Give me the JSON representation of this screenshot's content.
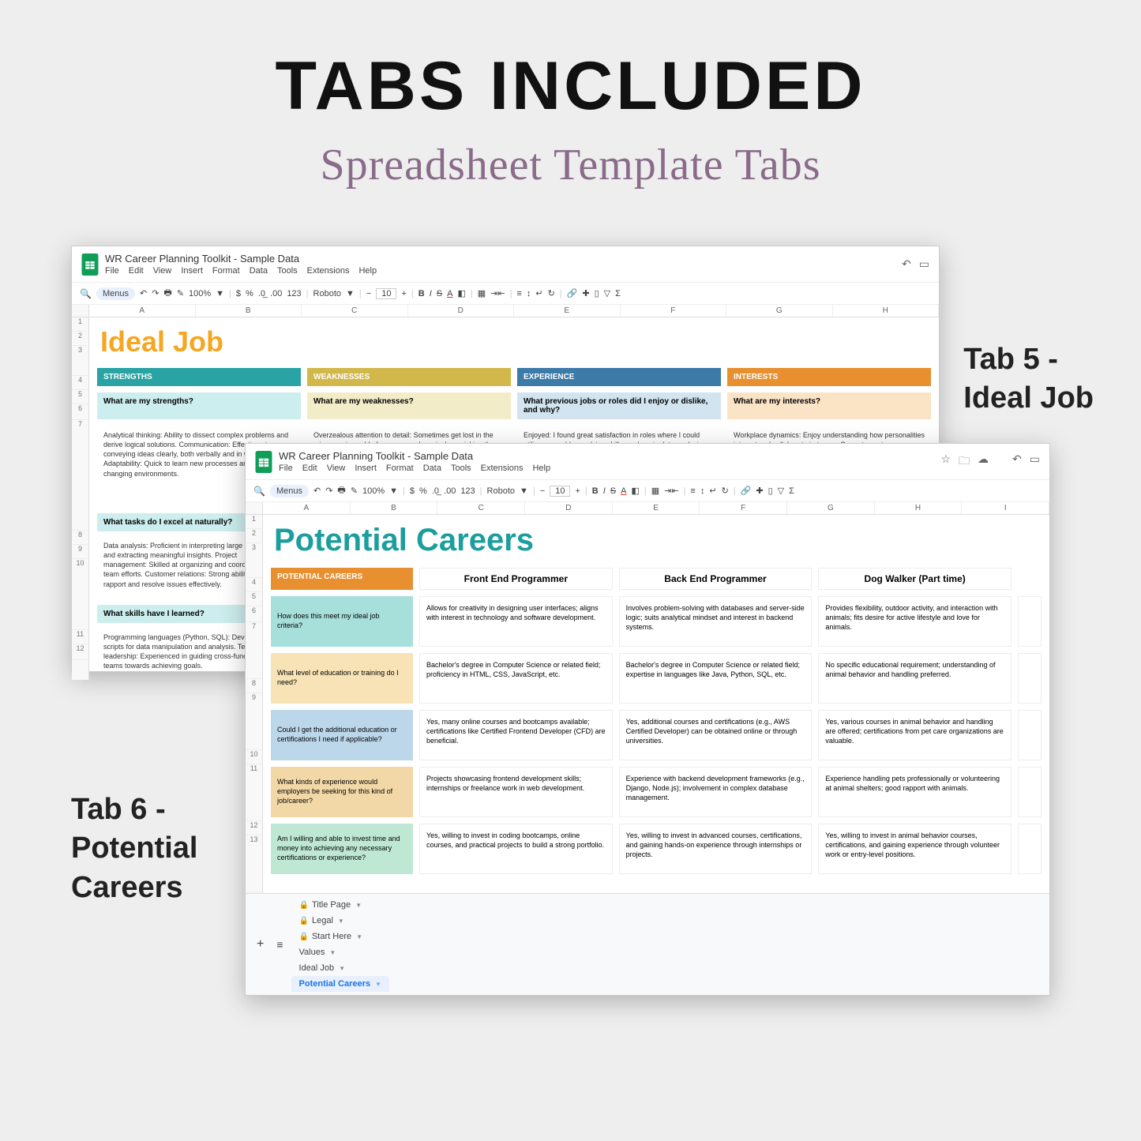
{
  "hero": {
    "title": "TABS INCLUDED",
    "subtitle": "Spreadsheet Template Tabs"
  },
  "labels": {
    "right": "Tab 5 -\nIdeal Job",
    "left": "Tab 6 -\nPotential\nCareers"
  },
  "doc": {
    "title": "WR Career Planning Toolkit - Sample Data",
    "menus": [
      "File",
      "Edit",
      "View",
      "Insert",
      "Format",
      "Data",
      "Tools",
      "Extensions",
      "Help"
    ],
    "search": "Menus",
    "font": "Roboto",
    "fontsize": "10",
    "zoom": "100%",
    "cols_back": [
      "A",
      "B",
      "C",
      "D",
      "E",
      "F",
      "G",
      "H"
    ],
    "cols_front": [
      "A",
      "B",
      "C",
      "D",
      "E",
      "F",
      "G",
      "H",
      "I"
    ]
  },
  "tabs": [
    "Title Page",
    "Legal",
    "Start Here",
    "Values",
    "Ideal Job",
    "Potential Careers"
  ],
  "idealJob": {
    "heading": "Ideal Job",
    "columns": [
      {
        "head": "STRENGTHS",
        "headClass": "c-teal",
        "sub": "What are my strengths?",
        "subClass": "c-tealL",
        "text": "Analytical thinking: Ability to dissect complex problems and derive logical solutions.\nCommunication: Effective at conveying ideas clearly, both verbally and in writing.\nAdaptability: Quick to learn new processes and adjust to changing environments."
      },
      {
        "head": "WEAKNESSES",
        "headClass": "c-gold",
        "sub": "What are my weaknesses?",
        "subClass": "c-goldL",
        "text": "Overzealous attention to detail: Sometimes get lost in the microscopic world of commas and semicolons, risking the big picture.\nSpontaneous pun syndrome: Occasionally suffer from a spontaneous outbreak of puns, which can derail serious discussions.\nOccasional nocturnal coding: Have been known to wake up with algorithms on the mind, leading to unconventional sleep schedules."
      },
      {
        "head": "EXPERIENCE",
        "headClass": "c-blue",
        "sub": "What previous jobs or roles did I enjoy or dislike, and why?",
        "subClass": "c-blueL",
        "text": "Enjoyed: I found great satisfaction in roles where I could utilize my problem-solving skills, such as in data analysis or project management. These roles allowed me to tackle challenges methodically and see tangible results.\nDisliked: Positions requiring extensive cold calling or sales pitches were challenging for me. I struggled with the pressure of initiating conversations and persuading others."
      },
      {
        "head": "INTERESTS",
        "headClass": "c-orng",
        "sub": "What are my interests?",
        "subClass": "c-orngL",
        "text": "Workplace dynamics: Enjoy understanding how personalities interact and collaborate in teams.\nCurrent events discussions: Like staying informed and discussing how it impacts our work.\nPersonal development: Interested in learning communication styles and improving teamwork."
      }
    ],
    "second": {
      "sub": "What tasks do I excel at naturally?",
      "text": "Data analysis: Proficient in interpreting large datasets and extracting meaningful insights.\nProject management: Skilled at organizing and coordinating team efforts.\nCustomer relations: Strong ability to build rapport and resolve issues effectively."
    },
    "third": {
      "sub": "What skills have I learned?",
      "text": "Programming languages (Python, SQL): Developed scripts for data manipulation and analysis.\nTeam leadership: Experienced in guiding cross-functional teams towards achieving goals."
    }
  },
  "potential": {
    "heading": "Potential Careers",
    "cornerHead": "POTENTIAL CAREERS",
    "colHeads": [
      "Front End Programmer",
      "Back End Programmer",
      "Dog Walker (Part time)"
    ],
    "rows": [
      {
        "q": "How does this meet my ideal job criteria?",
        "qClass": "q-teal",
        "a": [
          "Allows for creativity in designing user interfaces; aligns with interest in technology and software development.",
          "Involves problem-solving with databases and server-side logic; suits analytical mindset and interest in backend systems.",
          "Provides flexibility, outdoor activity, and interaction with animals; fits desire for active lifestyle and love for animals."
        ]
      },
      {
        "q": "What level of education or training do I need?",
        "qClass": "q-cream",
        "a": [
          "Bachelor's degree in Computer Science or related field; proficiency in HTML, CSS, JavaScript, etc.",
          "Bachelor's degree in Computer Science or related field; expertise in languages like Java, Python, SQL, etc.",
          "No specific educational requirement; understanding of animal behavior and handling preferred."
        ]
      },
      {
        "q": "Could I get the additional education or certifications I need if applicable?",
        "qClass": "q-blue",
        "a": [
          "Yes, many online courses and bootcamps available; certifications like Certified Frontend Developer (CFD) are beneficial.",
          "Yes, additional courses and certifications (e.g., AWS Certified Developer) can be obtained online or through universities.",
          "Yes, various courses in animal behavior and handling are offered; certifications from pet care organizations are valuable."
        ]
      },
      {
        "q": "What kinds of experience would employers be seeking for this kind of job/career?",
        "qClass": "q-tan",
        "a": [
          "Projects showcasing frontend development skills; internships or freelance work in web development.",
          "Experience with backend development frameworks (e.g., Django, Node.js); involvement in complex database management.",
          "Experience handling pets professionally or volunteering at animal shelters; good rapport with animals."
        ]
      },
      {
        "q": "Am I willing and able to invest time and money into achieving any necessary certifications or experience?",
        "qClass": "q-mint",
        "a": [
          "Yes, willing to invest in coding bootcamps, online courses, and practical projects to build a strong portfolio.",
          "Yes, willing to invest in advanced courses, certifications, and gaining hands-on experience through internships or projects.",
          "Yes, willing to invest in animal behavior courses, certifications, and gaining experience through volunteer work or entry-level positions."
        ]
      }
    ]
  }
}
